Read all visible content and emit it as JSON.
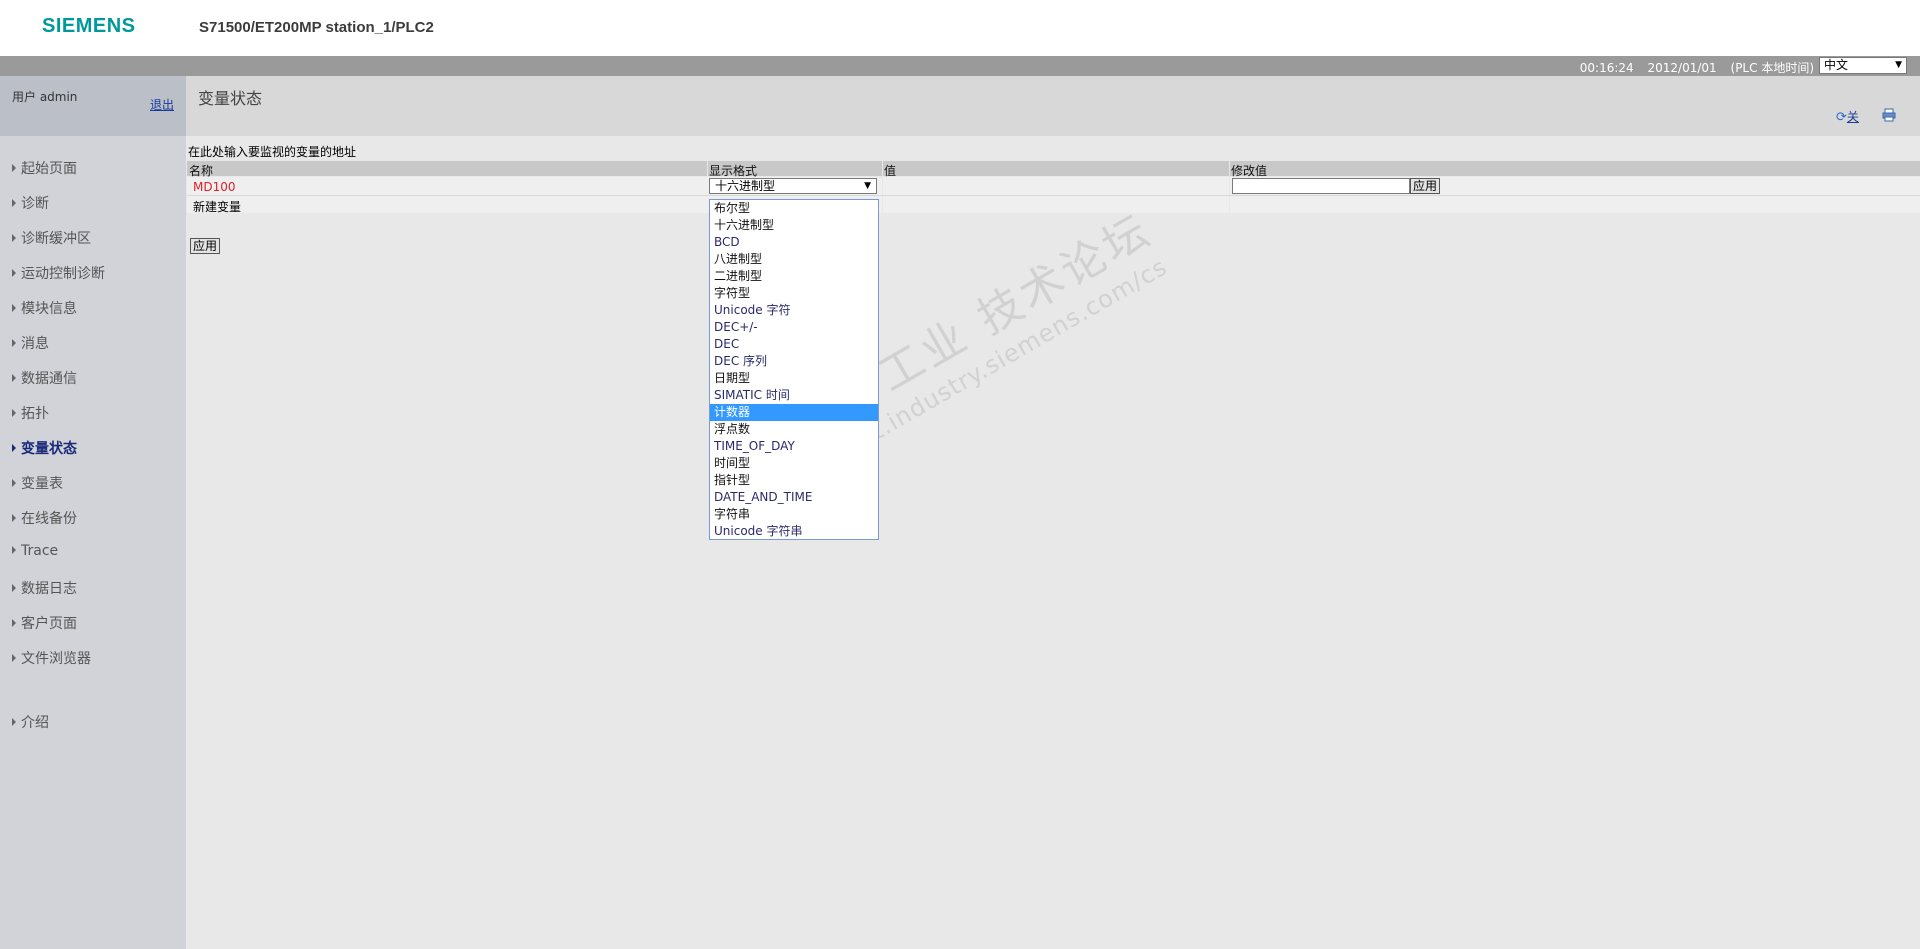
{
  "header": {
    "logo": "SIEMENS",
    "station": "S71500/ET200MP station_1/PLC2"
  },
  "statusbar": {
    "time": "00:16:24",
    "date": "2012/01/01",
    "timezone": "(PLC 本地时间)",
    "language": "中文"
  },
  "sidebar": {
    "user_label": "用户 admin",
    "logout": "退出",
    "items": [
      {
        "label": "起始页面"
      },
      {
        "label": "诊断"
      },
      {
        "label": "诊断缓冲区"
      },
      {
        "label": "运动控制诊断"
      },
      {
        "label": "模块信息"
      },
      {
        "label": "消息"
      },
      {
        "label": "数据通信"
      },
      {
        "label": "拓扑"
      },
      {
        "label": "变量状态"
      },
      {
        "label": "变量表"
      },
      {
        "label": "在线备份"
      },
      {
        "label": "Trace"
      },
      {
        "label": "数据日志"
      },
      {
        "label": "客户页面"
      },
      {
        "label": "文件浏览器"
      },
      {
        "label": "介绍"
      }
    ],
    "active_item": "变量状态"
  },
  "main": {
    "title": "变量状态",
    "refresh_label": "关",
    "hint": "在此处输入要监视的变量的地址",
    "columns": [
      "名称",
      "显示格式",
      "值",
      "修改值"
    ],
    "rows": [
      {
        "name": "MD100",
        "format": "十六进制型",
        "value": "",
        "modify_value": ""
      }
    ],
    "new_variable": "新建变量",
    "apply_button": "应用",
    "row_apply_button": "应用"
  },
  "dropdown": {
    "options": [
      "布尔型",
      "十六进制型",
      "BCD",
      "八进制型",
      "二进制型",
      "字符型",
      "Unicode 字符",
      "DEC+/-",
      "DEC",
      "DEC 序列",
      "日期型",
      "SIMATIC 时间",
      "计数器",
      "浮点数",
      "TIME_OF_DAY",
      "时间型",
      "指针型",
      "DATE_AND_TIME",
      "字符串",
      "Unicode 字符串"
    ],
    "highlighted": "计数器"
  },
  "watermark": {
    "line1": "西门子工业 技术论坛",
    "line2": "support.industry.siemens.com/cs"
  },
  "colors": {
    "brand": "#009999",
    "error_text": "#e0202a",
    "selection": "#3399ff",
    "link": "#1a3a9a"
  },
  "icons": {
    "refresh": "refresh-icon",
    "print": "print-icon"
  }
}
